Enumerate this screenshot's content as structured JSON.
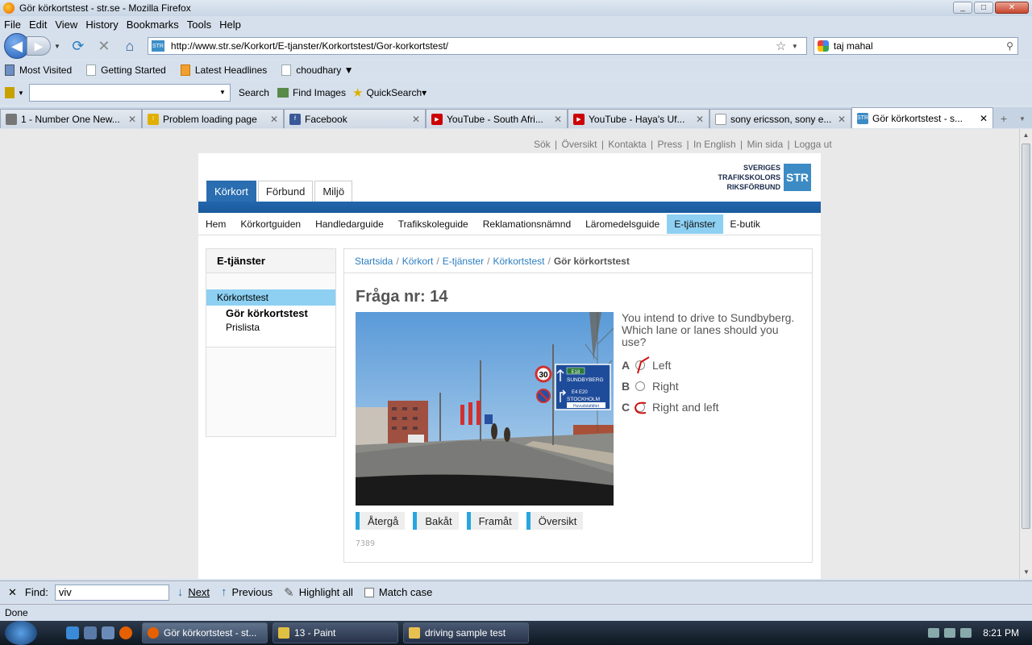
{
  "window": {
    "title": "Gör körkortstest - str.se - Mozilla Firefox",
    "min": "_",
    "max": "□",
    "close": "✕"
  },
  "menu": [
    "File",
    "Edit",
    "View",
    "History",
    "Bookmarks",
    "Tools",
    "Help"
  ],
  "nav": {
    "url": "http://www.str.se/Korkort/E-tjanster/Korkortstest/Gor-korkortstest/",
    "search_value": "taj mahal",
    "favicon_text": "STR"
  },
  "bookmarks": [
    "Most Visited",
    "Getting Started",
    "Latest Headlines",
    "choudhary ▼"
  ],
  "toolbar2": {
    "search_label": "Search",
    "images_label": "Find Images",
    "quicksearch_label": "QuickSearch▾"
  },
  "tabs": [
    {
      "label": "1 - Number One New...",
      "icon": "site-icon"
    },
    {
      "label": "Problem loading page",
      "icon": "warning-icon"
    },
    {
      "label": "Facebook",
      "icon": "facebook-icon"
    },
    {
      "label": "YouTube - South Afri...",
      "icon": "youtube-icon"
    },
    {
      "label": "YouTube - Haya's Uf...",
      "icon": "youtube-icon"
    },
    {
      "label": "sony ericsson, sony e...",
      "icon": "page-icon"
    },
    {
      "label": "Gör körkortstest - s...",
      "icon": "str-icon"
    }
  ],
  "site": {
    "toplinks": [
      "Sök",
      "Översikt",
      "Kontakta",
      "Press",
      "In English",
      "Min sida",
      "Logga ut"
    ],
    "logo_lines": [
      "SVERIGES",
      "TRAFIKSKOLORS",
      "RIKSFÖRBUND"
    ],
    "logo_box": "STR",
    "maintabs": [
      "Körkort",
      "Förbund",
      "Miljö"
    ],
    "subnav": [
      "Hem",
      "Körkortguiden",
      "Handledarguide",
      "Trafikskoleguide",
      "Reklamationsnämnd",
      "Läromedelsguide",
      "E-tjänster",
      "E-butik"
    ],
    "sidebar": {
      "title": "E-tjänster",
      "selected": "Körkortstest",
      "items": [
        "Gör körkortstest",
        "Prislista"
      ]
    },
    "breadcrumb": [
      "Startsida",
      "Körkort",
      "E-tjänster",
      "Körkortstest"
    ],
    "breadcrumb_current": "Gör körkortstest",
    "question_title": "Fråga nr: 14",
    "question_text": "You intend to drive to Sundbyberg. Which lane or lanes should you use?",
    "options": [
      {
        "letter": "A",
        "label": "Left"
      },
      {
        "letter": "B",
        "label": "Right"
      },
      {
        "letter": "C",
        "label": "Right and left"
      }
    ],
    "buttons": [
      "Återgå",
      "Bakåt",
      "Framåt",
      "Översikt"
    ],
    "code": "7389",
    "sign": {
      "speed": "30",
      "e18": "E18",
      "sundbyberg": "SUNDBYBERG",
      "e4": "E4",
      "e20": "E20",
      "stockholm": "STOCKHOLM",
      "sub": "Huvudstafältet"
    }
  },
  "findbar": {
    "label": "Find:",
    "value": "viv",
    "next": "Next",
    "previous": "Previous",
    "highlight": "Highlight all",
    "match": "Match case"
  },
  "status": "Done",
  "taskbar": {
    "tasks": [
      "Gör körkortstest - st...",
      "13 - Paint",
      "driving sample test"
    ],
    "time": "8:21 PM"
  }
}
